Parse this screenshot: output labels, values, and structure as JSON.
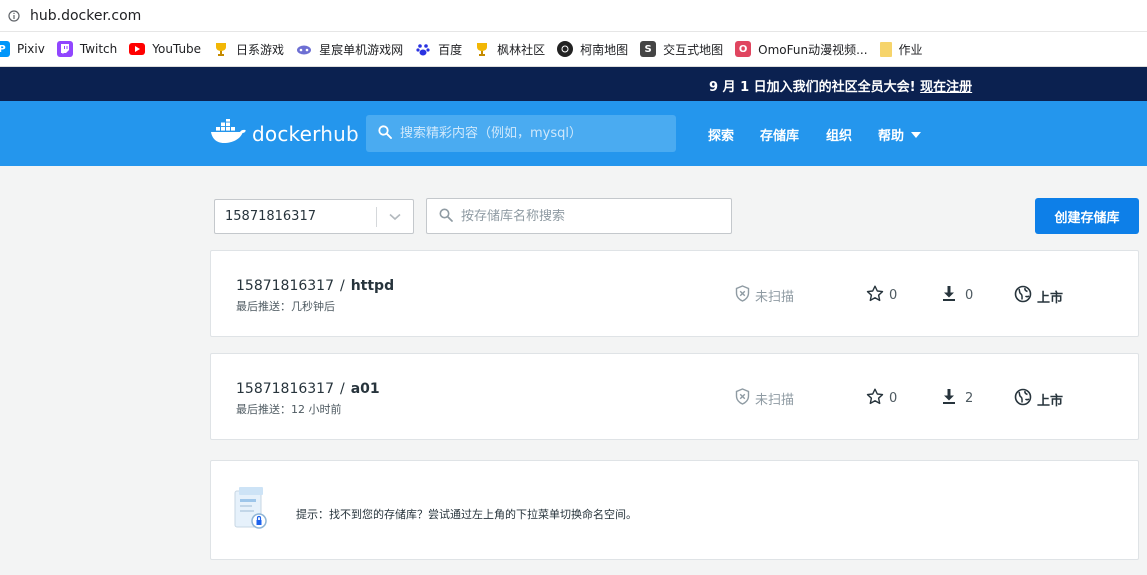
{
  "browser": {
    "url": "hub.docker.com",
    "bookmarks": [
      {
        "label": "Pixiv",
        "icon": "pixiv-icon",
        "color": "#0096fa"
      },
      {
        "label": "Twitch",
        "icon": "twitch-icon",
        "color": "#9146ff"
      },
      {
        "label": "YouTube",
        "icon": "youtube-icon",
        "color": "#ff0000"
      },
      {
        "label": "日系游戏",
        "icon": "trophy-icon",
        "color": "#f2b705"
      },
      {
        "label": "星宸单机游戏网",
        "icon": "gamepad-icon",
        "color": "#6d6fd3"
      },
      {
        "label": "百度",
        "icon": "baidu-paw-icon",
        "color": "#2932e1"
      },
      {
        "label": "枫林社区",
        "icon": "trophy-icon",
        "color": "#f2b705"
      },
      {
        "label": "柯南地图",
        "icon": "circle-logo-icon",
        "color": "#333333"
      },
      {
        "label": "交互式地图",
        "icon": "s-logo-icon",
        "color": "#444444"
      },
      {
        "label": "OmoFun动漫视频...",
        "icon": "omofun-icon",
        "color": "#e0455f"
      },
      {
        "label": "作业",
        "icon": "folder-icon",
        "color": "#f6d46b"
      }
    ]
  },
  "banner": {
    "text": "9 月 1 日加入我们的社区全员大会!",
    "link": "现在注册"
  },
  "header": {
    "logo_docker": "docker",
    "logo_hub": "hub",
    "search_placeholder": "搜索精彩内容（例如，mysql）",
    "nav": {
      "explore": "探索",
      "repositories": "存储库",
      "organizations": "组织",
      "help": "帮助"
    }
  },
  "toolbar": {
    "namespace": "15871816317",
    "repo_search_placeholder": "按存储库名称搜索",
    "create_button": "创建存储库"
  },
  "repositories": [
    {
      "namespace": "15871816317",
      "separator": "/",
      "name": "httpd",
      "last_push": "最后推送：几秒钟后",
      "scan_status": "未扫描",
      "stars": "0",
      "pulls": "0",
      "visibility": "上市"
    },
    {
      "namespace": "15871816317",
      "separator": "/",
      "name": "a01",
      "last_push": "最后推送：12 小时前",
      "scan_status": "未扫描",
      "stars": "0",
      "pulls": "2",
      "visibility": "上市"
    }
  ],
  "tip": {
    "text": "提示：找不到您的存储库？尝试通过左上角的下拉菜单切换命名空间。"
  },
  "colors": {
    "banner_bg": "#0b2150",
    "header_bg": "#2496ed",
    "primary_button": "#0d7fe8"
  }
}
